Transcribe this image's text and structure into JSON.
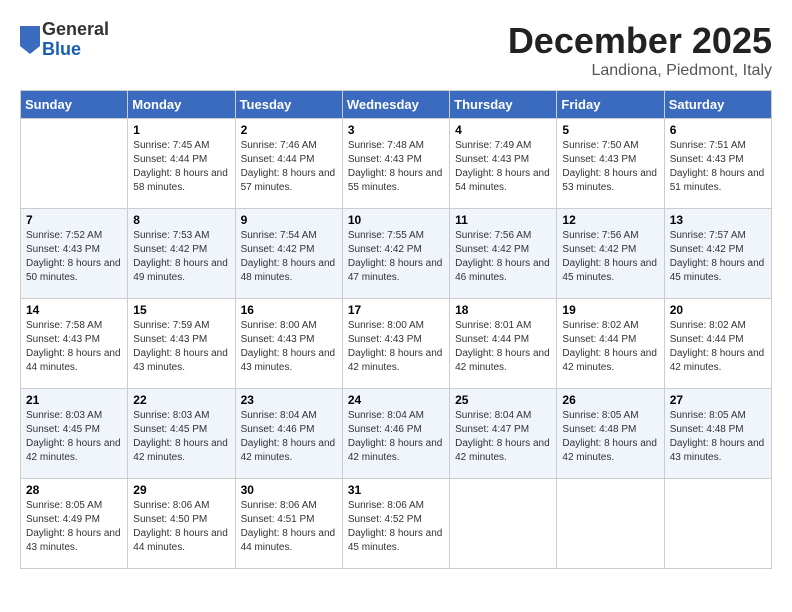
{
  "logo": {
    "general": "General",
    "blue": "Blue"
  },
  "title": "December 2025",
  "location": "Landiona, Piedmont, Italy",
  "days_of_week": [
    "Sunday",
    "Monday",
    "Tuesday",
    "Wednesday",
    "Thursday",
    "Friday",
    "Saturday"
  ],
  "weeks": [
    [
      {
        "day": "",
        "sunrise": "",
        "sunset": "",
        "daylight": ""
      },
      {
        "day": "1",
        "sunrise": "Sunrise: 7:45 AM",
        "sunset": "Sunset: 4:44 PM",
        "daylight": "Daylight: 8 hours and 58 minutes."
      },
      {
        "day": "2",
        "sunrise": "Sunrise: 7:46 AM",
        "sunset": "Sunset: 4:44 PM",
        "daylight": "Daylight: 8 hours and 57 minutes."
      },
      {
        "day": "3",
        "sunrise": "Sunrise: 7:48 AM",
        "sunset": "Sunset: 4:43 PM",
        "daylight": "Daylight: 8 hours and 55 minutes."
      },
      {
        "day": "4",
        "sunrise": "Sunrise: 7:49 AM",
        "sunset": "Sunset: 4:43 PM",
        "daylight": "Daylight: 8 hours and 54 minutes."
      },
      {
        "day": "5",
        "sunrise": "Sunrise: 7:50 AM",
        "sunset": "Sunset: 4:43 PM",
        "daylight": "Daylight: 8 hours and 53 minutes."
      },
      {
        "day": "6",
        "sunrise": "Sunrise: 7:51 AM",
        "sunset": "Sunset: 4:43 PM",
        "daylight": "Daylight: 8 hours and 51 minutes."
      }
    ],
    [
      {
        "day": "7",
        "sunrise": "Sunrise: 7:52 AM",
        "sunset": "Sunset: 4:43 PM",
        "daylight": "Daylight: 8 hours and 50 minutes."
      },
      {
        "day": "8",
        "sunrise": "Sunrise: 7:53 AM",
        "sunset": "Sunset: 4:42 PM",
        "daylight": "Daylight: 8 hours and 49 minutes."
      },
      {
        "day": "9",
        "sunrise": "Sunrise: 7:54 AM",
        "sunset": "Sunset: 4:42 PM",
        "daylight": "Daylight: 8 hours and 48 minutes."
      },
      {
        "day": "10",
        "sunrise": "Sunrise: 7:55 AM",
        "sunset": "Sunset: 4:42 PM",
        "daylight": "Daylight: 8 hours and 47 minutes."
      },
      {
        "day": "11",
        "sunrise": "Sunrise: 7:56 AM",
        "sunset": "Sunset: 4:42 PM",
        "daylight": "Daylight: 8 hours and 46 minutes."
      },
      {
        "day": "12",
        "sunrise": "Sunrise: 7:56 AM",
        "sunset": "Sunset: 4:42 PM",
        "daylight": "Daylight: 8 hours and 45 minutes."
      },
      {
        "day": "13",
        "sunrise": "Sunrise: 7:57 AM",
        "sunset": "Sunset: 4:42 PM",
        "daylight": "Daylight: 8 hours and 45 minutes."
      }
    ],
    [
      {
        "day": "14",
        "sunrise": "Sunrise: 7:58 AM",
        "sunset": "Sunset: 4:43 PM",
        "daylight": "Daylight: 8 hours and 44 minutes."
      },
      {
        "day": "15",
        "sunrise": "Sunrise: 7:59 AM",
        "sunset": "Sunset: 4:43 PM",
        "daylight": "Daylight: 8 hours and 43 minutes."
      },
      {
        "day": "16",
        "sunrise": "Sunrise: 8:00 AM",
        "sunset": "Sunset: 4:43 PM",
        "daylight": "Daylight: 8 hours and 43 minutes."
      },
      {
        "day": "17",
        "sunrise": "Sunrise: 8:00 AM",
        "sunset": "Sunset: 4:43 PM",
        "daylight": "Daylight: 8 hours and 42 minutes."
      },
      {
        "day": "18",
        "sunrise": "Sunrise: 8:01 AM",
        "sunset": "Sunset: 4:44 PM",
        "daylight": "Daylight: 8 hours and 42 minutes."
      },
      {
        "day": "19",
        "sunrise": "Sunrise: 8:02 AM",
        "sunset": "Sunset: 4:44 PM",
        "daylight": "Daylight: 8 hours and 42 minutes."
      },
      {
        "day": "20",
        "sunrise": "Sunrise: 8:02 AM",
        "sunset": "Sunset: 4:44 PM",
        "daylight": "Daylight: 8 hours and 42 minutes."
      }
    ],
    [
      {
        "day": "21",
        "sunrise": "Sunrise: 8:03 AM",
        "sunset": "Sunset: 4:45 PM",
        "daylight": "Daylight: 8 hours and 42 minutes."
      },
      {
        "day": "22",
        "sunrise": "Sunrise: 8:03 AM",
        "sunset": "Sunset: 4:45 PM",
        "daylight": "Daylight: 8 hours and 42 minutes."
      },
      {
        "day": "23",
        "sunrise": "Sunrise: 8:04 AM",
        "sunset": "Sunset: 4:46 PM",
        "daylight": "Daylight: 8 hours and 42 minutes."
      },
      {
        "day": "24",
        "sunrise": "Sunrise: 8:04 AM",
        "sunset": "Sunset: 4:46 PM",
        "daylight": "Daylight: 8 hours and 42 minutes."
      },
      {
        "day": "25",
        "sunrise": "Sunrise: 8:04 AM",
        "sunset": "Sunset: 4:47 PM",
        "daylight": "Daylight: 8 hours and 42 minutes."
      },
      {
        "day": "26",
        "sunrise": "Sunrise: 8:05 AM",
        "sunset": "Sunset: 4:48 PM",
        "daylight": "Daylight: 8 hours and 42 minutes."
      },
      {
        "day": "27",
        "sunrise": "Sunrise: 8:05 AM",
        "sunset": "Sunset: 4:48 PM",
        "daylight": "Daylight: 8 hours and 43 minutes."
      }
    ],
    [
      {
        "day": "28",
        "sunrise": "Sunrise: 8:05 AM",
        "sunset": "Sunset: 4:49 PM",
        "daylight": "Daylight: 8 hours and 43 minutes."
      },
      {
        "day": "29",
        "sunrise": "Sunrise: 8:06 AM",
        "sunset": "Sunset: 4:50 PM",
        "daylight": "Daylight: 8 hours and 44 minutes."
      },
      {
        "day": "30",
        "sunrise": "Sunrise: 8:06 AM",
        "sunset": "Sunset: 4:51 PM",
        "daylight": "Daylight: 8 hours and 44 minutes."
      },
      {
        "day": "31",
        "sunrise": "Sunrise: 8:06 AM",
        "sunset": "Sunset: 4:52 PM",
        "daylight": "Daylight: 8 hours and 45 minutes."
      },
      {
        "day": "",
        "sunrise": "",
        "sunset": "",
        "daylight": ""
      },
      {
        "day": "",
        "sunrise": "",
        "sunset": "",
        "daylight": ""
      },
      {
        "day": "",
        "sunrise": "",
        "sunset": "",
        "daylight": ""
      }
    ]
  ]
}
